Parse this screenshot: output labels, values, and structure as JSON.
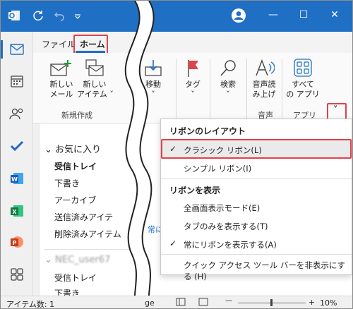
{
  "titlebar": {
    "app_icon": "outlook-icon",
    "sync_icon": "sync-icon",
    "undo_icon": "undo-icon",
    "qat_icon": "chevron-down-icon",
    "avatar_icon": "account-icon",
    "min": "—",
    "max": "☐",
    "close": "✕",
    "accent": "#1f6fc4"
  },
  "tabs": {
    "file": "ファイル",
    "home": "ホーム"
  },
  "ribbon": {
    "new_mail": "新しい\nメール",
    "new_item": "新しい\nアイテム ˅",
    "group_new": "新規作成",
    "move": "移動",
    "move_arrow": "˅",
    "tag": "タグ",
    "tag_arrow": "˅",
    "search": "検索",
    "search_arrow": "˅",
    "read_aloud": "音声読\nみ上げ",
    "group_voice": "音声",
    "all_apps": "すべて\nの アプリ",
    "group_apps": "アプリ",
    "expand_chevron": "˅"
  },
  "nav": {
    "favorites": "お気に入り",
    "items": [
      "受信トレイ",
      "下書き",
      "アーカイブ",
      "送信済みアイテ",
      "削除済みアイテム"
    ],
    "account": "NEC_user67",
    "account_items": [
      "受信トレイ",
      "下書き"
    ]
  },
  "msg": {
    "partial": "常に"
  },
  "dropdown": {
    "header1": "リボンのレイアウト",
    "classic": "クラシック リボン(L)",
    "simple": "シンプル リボン(I)",
    "header2": "リボンを表示",
    "fullscreen": "全画面表示モード(E)",
    "tabs_only": "タブのみを表示する(T)",
    "always": "常にリボンを表示する(A)",
    "hide_qat": "クイック アクセス ツール バーを非表示にする (H)"
  },
  "status": {
    "items": "アイテム数: 1",
    "partial": "ge",
    "zoom": "10%",
    "zoom_minus": "—",
    "zoom_plus": "+"
  }
}
